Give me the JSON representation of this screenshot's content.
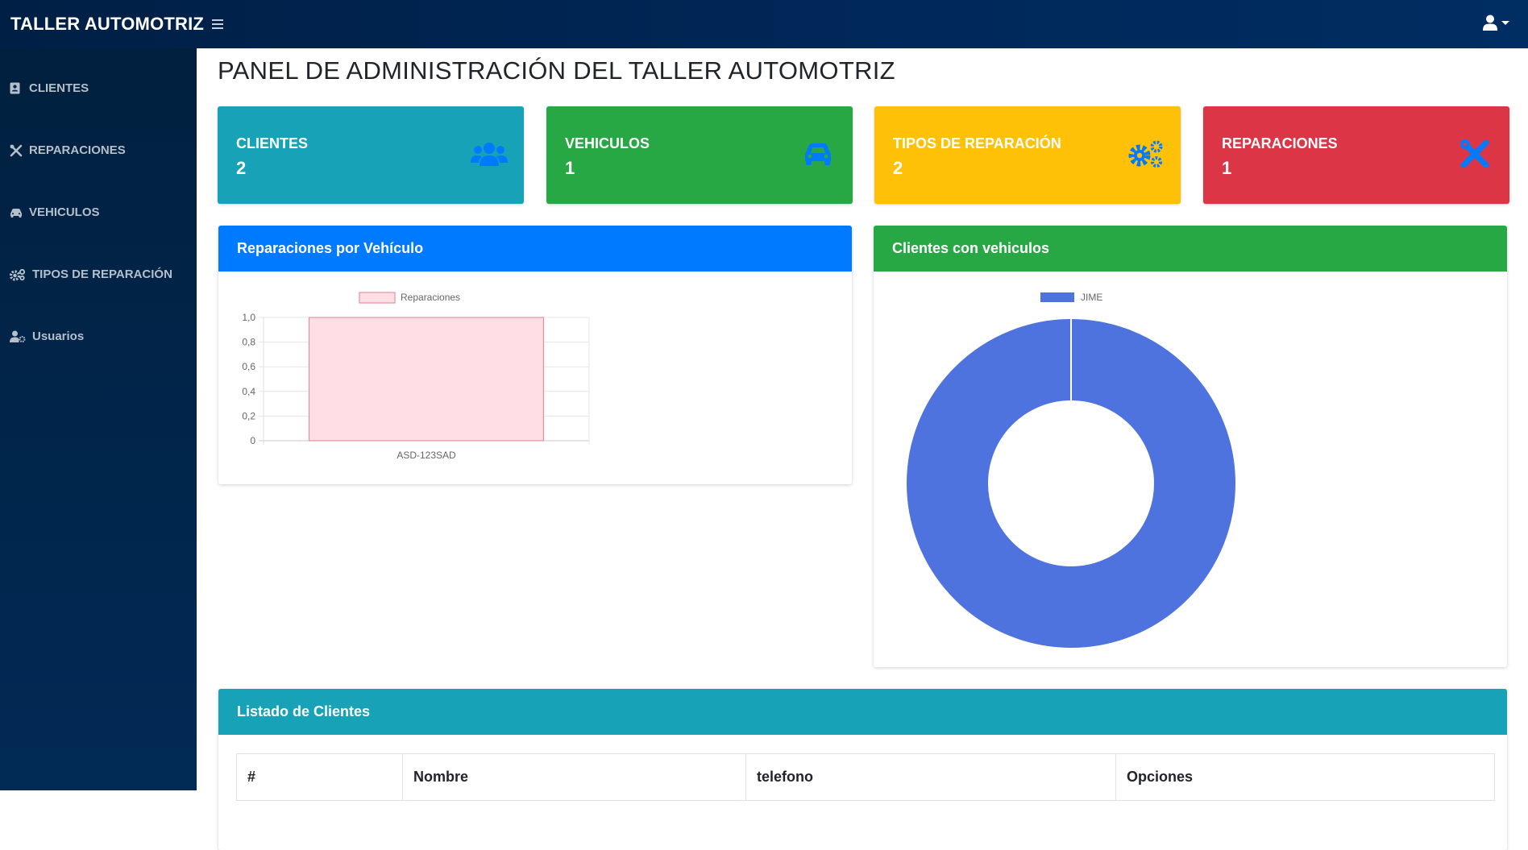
{
  "app": {
    "brand": "TALLER AUTOMOTRIZ"
  },
  "sidebar": {
    "items": [
      {
        "label": "CLIENTES",
        "icon": "address-book-icon"
      },
      {
        "label": "REPARACIONES",
        "icon": "tools-icon"
      },
      {
        "label": "VEHICULOS",
        "icon": "car-icon"
      },
      {
        "label": "TIPOS DE REPARACIÓN",
        "icon": "cogs-icon"
      },
      {
        "label": "Usuarios",
        "icon": "user-cog-icon"
      }
    ]
  },
  "page": {
    "title": "PANEL DE ADMINISTRACIÓN DEL TALLER AUTOMOTRIZ"
  },
  "stats": [
    {
      "label": "CLIENTES",
      "value": "2",
      "color": "#17a2b8",
      "icon": "users-icon"
    },
    {
      "label": "VEHICULOS",
      "value": "1",
      "color": "#28a745",
      "icon": "car-icon"
    },
    {
      "label": "TIPOS DE REPARACIÓN",
      "value": "2",
      "color": "#ffc107",
      "icon": "cogs-icon"
    },
    {
      "label": "REPARACIONES",
      "value": "1",
      "color": "#dc3545",
      "icon": "tools-icon"
    }
  ],
  "icon_color": "#007bff",
  "cards": {
    "bar": {
      "title": "Reparaciones por Vehículo",
      "header_color": "#007bff"
    },
    "doughnut": {
      "title": "Clientes con vehiculos",
      "header_color": "#28a745"
    },
    "table": {
      "title": "Listado de Clientes",
      "header_color": "#17a2b8"
    }
  },
  "chart_data": [
    {
      "type": "bar",
      "categories": [
        "ASD-123SAD"
      ],
      "series": [
        {
          "name": "Reparaciones",
          "values": [
            1
          ],
          "fill": "#ffdfe5",
          "stroke": "#e58fa0"
        }
      ],
      "ylim": [
        0,
        1
      ],
      "yticks": [
        "0",
        "0,2",
        "0,4",
        "0,6",
        "0,8",
        "1,0"
      ],
      "legend": "top",
      "grid": true
    },
    {
      "type": "pie",
      "variant": "doughnut",
      "labels": [
        "JIME"
      ],
      "values": [
        1
      ],
      "colors": [
        "#4e73df"
      ],
      "legend": "top"
    }
  ],
  "table": {
    "columns": [
      "#",
      "Nombre",
      "telefono",
      "Opciones"
    ]
  }
}
